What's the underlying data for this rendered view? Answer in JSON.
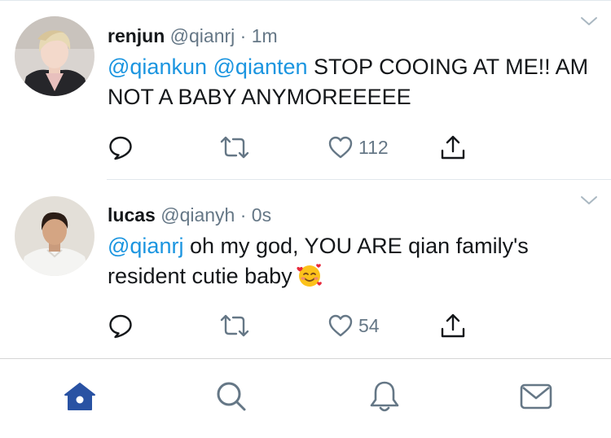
{
  "tweets": [
    {
      "name": "renjun",
      "handle": "@qianrj",
      "separator": "·",
      "time": "1m",
      "mentions": [
        "@qiankun",
        "@qianten"
      ],
      "text": "STOP COOING AT ME!! AM NOT A BABY ANYMOREEEEE",
      "reply_icon": "reply-icon",
      "retweet_icon": "retweet-icon",
      "like_icon": "heart-icon",
      "like_count": "112",
      "share_icon": "share-icon"
    },
    {
      "name": "lucas",
      "handle": "@qianyh",
      "separator": "·",
      "time": "0s",
      "mentions": [
        "@qianrj"
      ],
      "text": "oh my god, YOU ARE qian family's resident cutie baby",
      "emoji": "smiling-face-with-hearts-emoji",
      "reply_icon": "reply-icon",
      "retweet_icon": "retweet-icon",
      "like_icon": "heart-icon",
      "like_count": "54",
      "share_icon": "share-icon"
    }
  ],
  "tabbar": {
    "items": [
      "home-icon",
      "search-icon",
      "notifications-icon",
      "messages-icon"
    ],
    "active": "home-icon"
  },
  "colors": {
    "accent": "#1b95e0",
    "active_tab": "#2952a3",
    "secondary_text": "#657786",
    "divider": "#e1e8ed"
  }
}
